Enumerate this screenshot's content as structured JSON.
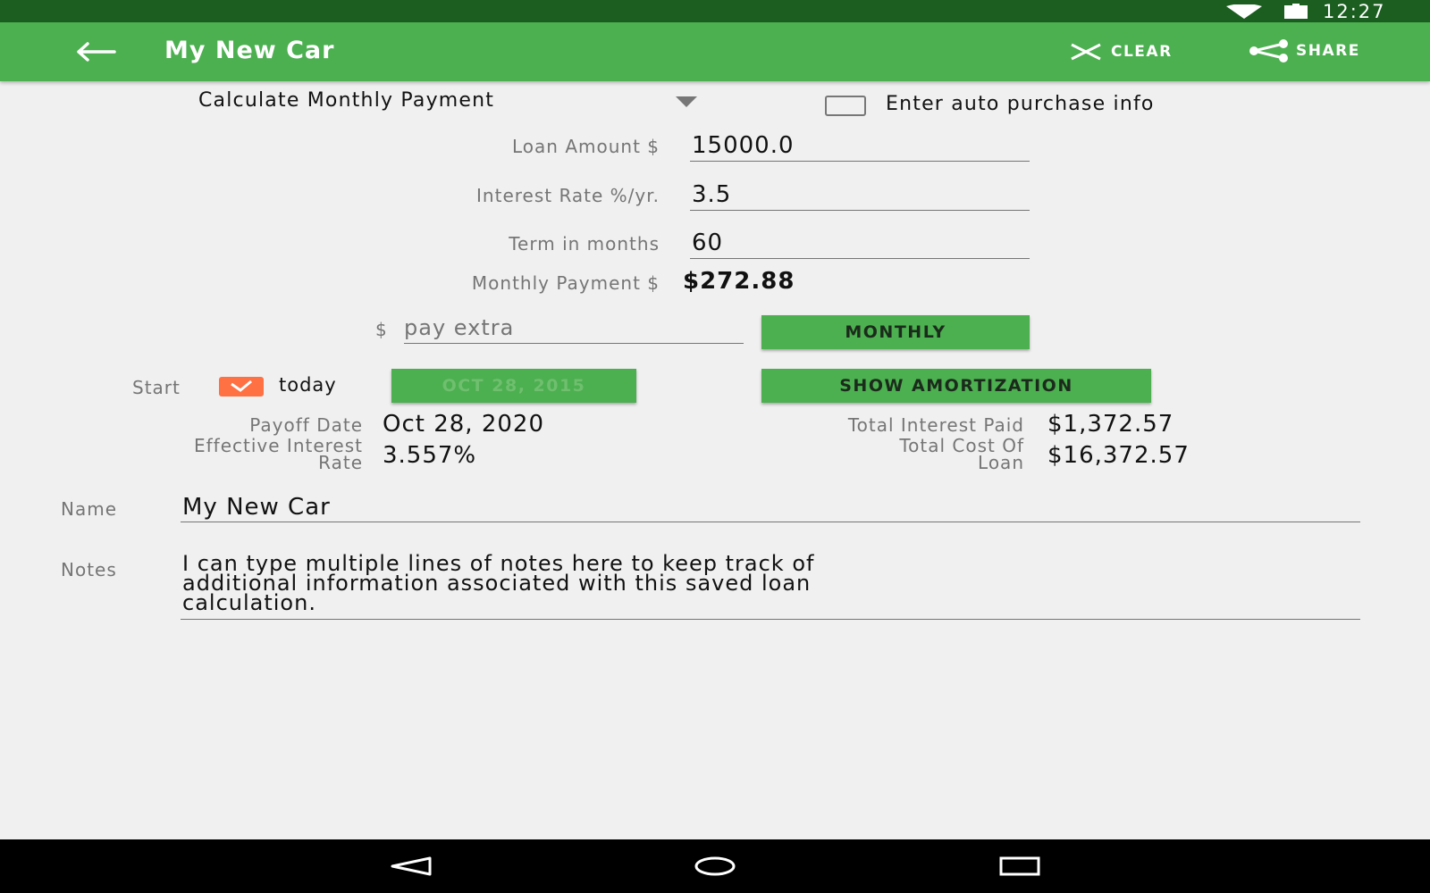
{
  "status_bar": {
    "time": "12:27"
  },
  "toolbar": {
    "title": "My New Car",
    "clear_label": "CLEAR",
    "share_label": "SHARE"
  },
  "calc_mode": {
    "selected": "Calculate Monthly Payment"
  },
  "auto_purchase": {
    "label": "Enter auto purchase info",
    "checked": false
  },
  "loan_amount": {
    "label": "Loan Amount $",
    "value": "15000.0"
  },
  "interest_rate": {
    "label": "Interest Rate %/yr.",
    "value": "3.5"
  },
  "term": {
    "label": "Term in months",
    "value": "60"
  },
  "monthly_payment": {
    "label": "Monthly Payment $",
    "value": "$272.88"
  },
  "extra": {
    "prefix": "$",
    "placeholder": "pay extra",
    "frequency_button": "MONTHLY"
  },
  "start": {
    "label": "Start",
    "today_label": "today",
    "today_checked": true,
    "date_button": "OCT 28, 2015"
  },
  "amortization_button": "SHOW AMORTIZATION",
  "results": {
    "payoff_label": "Payoff Date",
    "payoff_value": "Oct 28, 2020",
    "effective_rate_label_1": "Effective Interest",
    "effective_rate_label_2": "Rate",
    "effective_rate_value": "3.557%",
    "total_interest_label": "Total Interest Paid",
    "total_interest_value": "$1,372.57",
    "total_cost_label_1": "Total Cost Of",
    "total_cost_label_2": "Loan",
    "total_cost_value": "$16,372.57"
  },
  "name": {
    "label": "Name",
    "value": "My New Car"
  },
  "notes": {
    "label": "Notes",
    "line1": "I can type multiple lines of notes here to keep track of",
    "line2": "additional information associated with this saved loan",
    "line3": "calculation."
  },
  "colors": {
    "primary": "#4caf50",
    "primary_dark": "#1b5e20",
    "accent": "#ff7043"
  },
  "icons": [
    "wifi-icon",
    "battery-icon",
    "back-arrow-icon",
    "close-icon",
    "share-icon",
    "dropdown-arrow-icon",
    "nav-back-icon",
    "nav-home-icon",
    "nav-recents-icon"
  ]
}
